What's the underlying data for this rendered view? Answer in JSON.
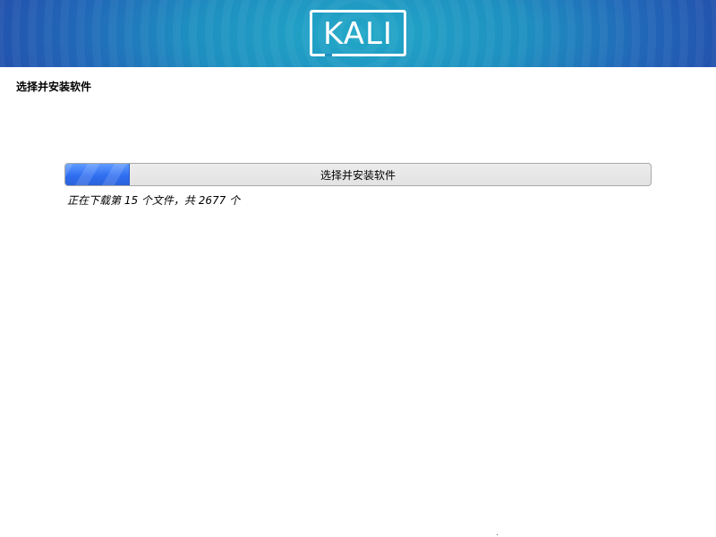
{
  "banner": {
    "logo_text": "KALI"
  },
  "page_title": "选择并安装软件",
  "progress": {
    "label": "选择并安装软件",
    "fraction": 0.11
  },
  "status_text": "正在下载第 15 个文件，共 2677 个",
  "colors": {
    "banner_center": "#22a8c8",
    "banner_edge": "#2351ad",
    "progress_fill": "#2f6ef0",
    "progress_track": "#e6e6e6"
  }
}
